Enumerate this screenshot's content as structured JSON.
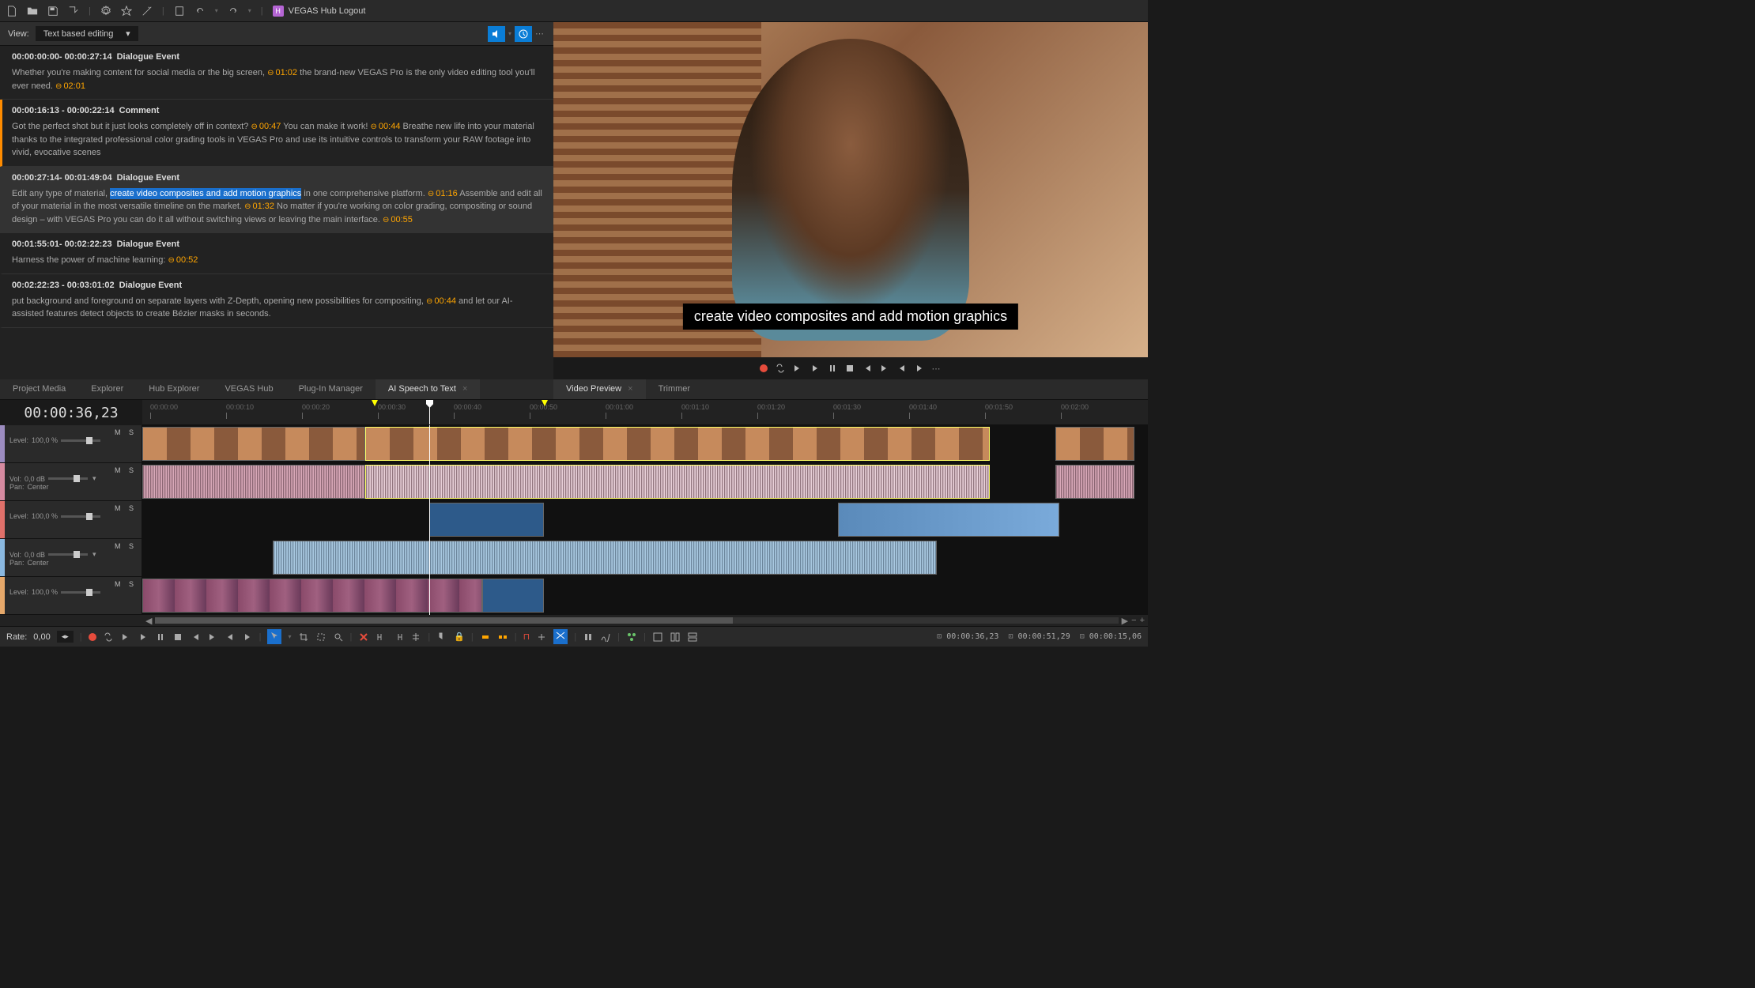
{
  "toolbar": {
    "hub_logout": "VEGAS Hub Logout"
  },
  "view_bar": {
    "label": "View:",
    "value": "Text based editing"
  },
  "events": [
    {
      "time": "00:00:00:00- 00:00:27:14",
      "type": "Dialogue Event",
      "text1": "Whether you're making content for social media or the big screen, ",
      "t1": "01:02",
      "text2": " the brand-new VEGAS Pro is the only video editing tool you'll ever need. ",
      "t2": "02:01"
    },
    {
      "time": "00:00:16:13 - 00:00:22:14",
      "type": "Comment",
      "class": "comment",
      "text1": "Got the perfect shot but it just looks completely off in context? ",
      "t1": "00:47",
      "text2": " You can make it work! ",
      "t2": "00:44",
      "text3": " Breathe new life into your material thanks to the integrated professional color grading tools in VEGAS Pro and use its intuitive controls to transform your RAW footage into vivid, evocative scenes"
    },
    {
      "time": "00:00:27:14- 00:01:49:04",
      "type": "Dialogue Event",
      "class": "active",
      "text1": "Edit any type of material, ",
      "highlight": "create video composites and add motion graphics",
      "text2": " in one comprehensive platform. ",
      "t1": "01:16",
      "text3": " Assemble and edit all of your material in the most versatile timeline on the market. ",
      "t2": "01:32",
      "text4": " No matter if you're working on color grading, compositing or sound design – with VEGAS Pro you can do it all without switching views or leaving the main interface. ",
      "t3": "00:55"
    },
    {
      "time": "00:01:55:01- 00:02:22:23",
      "type": "Dialogue Event",
      "text1": "Harness the power of machine learning: ",
      "t1": "00:52"
    },
    {
      "time": "00:02:22:23 - 00:03:01:02",
      "type": "Dialogue Event",
      "text1": "put background and foreground on separate layers with Z-Depth, opening new possibilities for compositing, ",
      "t1": "00:44",
      "text2": " and let our AI-assisted features detect objects to create Bézier masks in seconds."
    }
  ],
  "preview": {
    "caption": "create video composites and add motion graphics"
  },
  "tabs_left": [
    "Project Media",
    "Explorer",
    "Hub Explorer",
    "VEGAS Hub",
    "Plug-In Manager",
    "AI Speech to Text"
  ],
  "tabs_left_active": 5,
  "tabs_right": [
    "Video Preview",
    "Trimmer"
  ],
  "tabs_right_active": 0,
  "timecode": "00:00:36,23",
  "ruler_ticks": [
    "00:00:00",
    "00:00:10",
    "00:00:20",
    "00:00:30",
    "00:00:40",
    "00:00:50",
    "00:01:00",
    "00:01:10",
    "00:01:20",
    "00:01:30",
    "00:01:40",
    "00:01:50",
    "00:02:00"
  ],
  "tracks": {
    "t1": {
      "color": "#9c8cc0",
      "level": "Level:",
      "level_val": "100,0 %"
    },
    "t2": {
      "color": "#d68aa0",
      "vol": "Vol:",
      "vol_val": "0,0 dB",
      "pan": "Pan:",
      "pan_val": "Center"
    },
    "t3": {
      "color": "#e0706a",
      "level": "Level:",
      "level_val": "100,0 %"
    },
    "t4": {
      "color": "#8ab8e0",
      "vol": "Vol:",
      "vol_val": "0,0 dB",
      "pan": "Pan:",
      "pan_val": "Center"
    },
    "t5": {
      "color": "#e6a86a",
      "level": "Level:",
      "level_val": "100,0 %"
    }
  },
  "bottom": {
    "rate_label": "Rate:",
    "rate_value": "0,00"
  },
  "status_times": [
    "00:00:36,23",
    "00:00:51,29",
    "00:00:15,06"
  ],
  "ms": "M  S"
}
